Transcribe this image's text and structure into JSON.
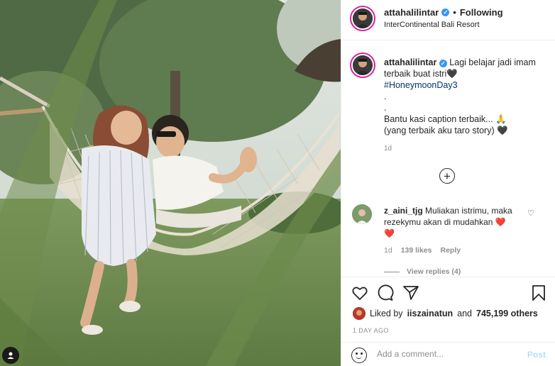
{
  "post": {
    "username": "attahalilintar",
    "verified_mark": "✓",
    "separator": "•",
    "follow_status": "Following",
    "location": "InterContinental Bali Resort"
  },
  "caption": {
    "username": "attahalilintar",
    "line1": "Lagi belajar jadi imam terbaik buat istri",
    "heart1": "🖤",
    "hashtag": "#HoneymoonDay3",
    "dot1": ".",
    "dot2": ".",
    "line2": "Bantu kasi caption terbaik...",
    "pray": "🙏",
    "line3": "(yang terbaik aku taro story)",
    "heart2": "🖤",
    "time": "1d"
  },
  "load_more": {
    "icon": "plus-circle-icon",
    "glyph": "+"
  },
  "comment": {
    "username": "z_aini_tjg",
    "text": "Muliakan istrimu, maka rezekymu akan di mudahkan",
    "heart_a": "❤️",
    "heart_b": "❤️",
    "time": "1d",
    "likes": "139 likes",
    "reply": "Reply",
    "view_replies": "View replies (4)",
    "like_glyph": "♡"
  },
  "actions": {
    "liked_by_prefix": "Liked by",
    "liked_by_user": "iiszainatun",
    "liked_by_and": "and",
    "liked_by_count": "745,199 others",
    "post_time": "1 DAY AGO"
  },
  "add_comment": {
    "placeholder": "Add a comment...",
    "post_label": "Post"
  },
  "colors": {
    "link": "#00376b",
    "post_button_disabled": "#b2dffc",
    "verified": "#3897f0",
    "story_ring": "#d6249f"
  }
}
